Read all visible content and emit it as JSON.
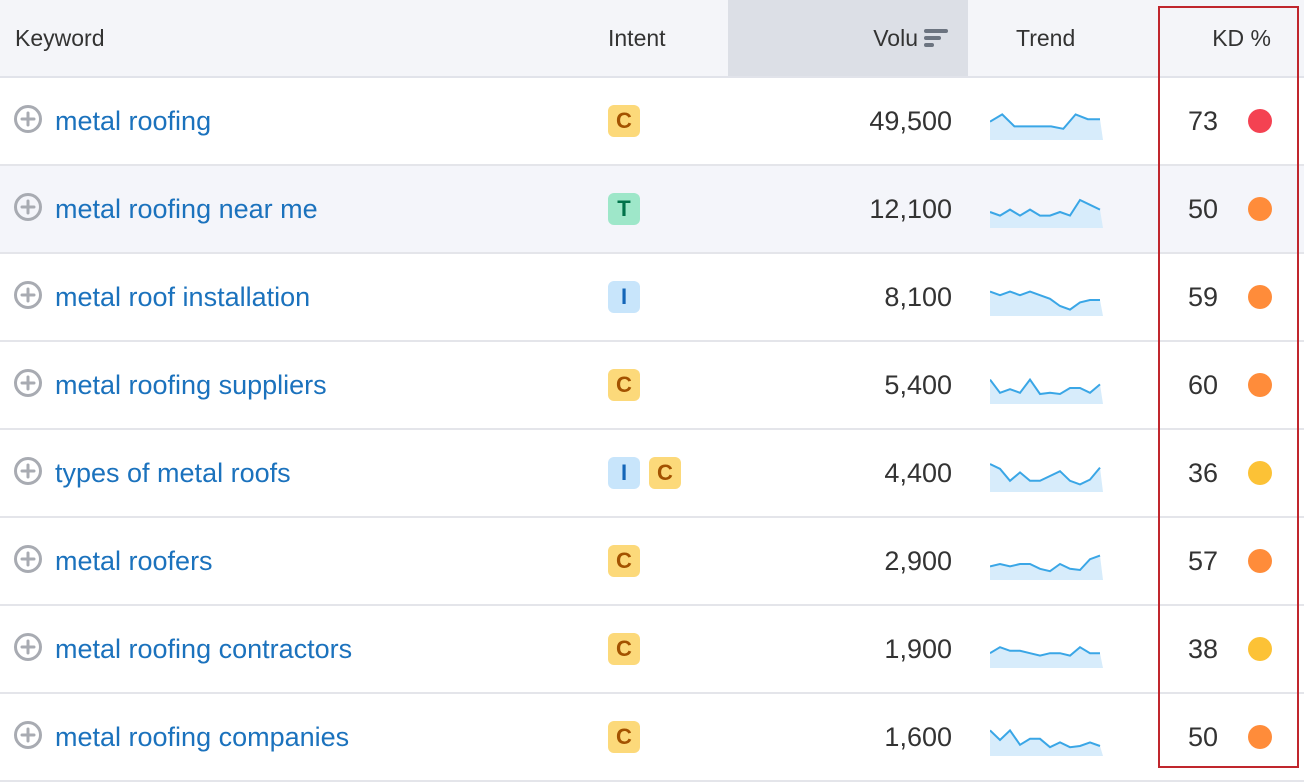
{
  "table": {
    "columns": {
      "keyword": "Keyword",
      "intent": "Intent",
      "volume": "Volu",
      "trend": "Trend",
      "kd": "KD %"
    },
    "sort_icon": "sort-descending-icon",
    "rows": [
      {
        "keyword": "metal roofing",
        "intents": [
          "C"
        ],
        "volume": "49,500",
        "kd": "73",
        "kd_color": "#f44252",
        "trend": [
          0.6,
          0.9,
          0.4,
          0.4,
          0.4,
          0.4,
          0.3,
          0.9,
          0.7,
          0.7
        ]
      },
      {
        "keyword": "metal roofing near me",
        "intents": [
          "T"
        ],
        "volume": "12,100",
        "kd": "50",
        "kd_color": "#ff8c3a",
        "trend": [
          0.5,
          0.35,
          0.6,
          0.35,
          0.6,
          0.35,
          0.35,
          0.5,
          0.35,
          1.0,
          0.8,
          0.6
        ]
      },
      {
        "keyword": "metal roof installation",
        "intents": [
          "I"
        ],
        "volume": "8,100",
        "kd": "59",
        "kd_color": "#ff8c3a",
        "trend": [
          0.85,
          0.7,
          0.85,
          0.7,
          0.85,
          0.7,
          0.55,
          0.25,
          0.1,
          0.4,
          0.5,
          0.5
        ]
      },
      {
        "keyword": "metal roofing suppliers",
        "intents": [
          "C"
        ],
        "volume": "5,400",
        "kd": "60",
        "kd_color": "#ff8c3a",
        "trend": [
          0.85,
          0.3,
          0.45,
          0.3,
          0.85,
          0.25,
          0.3,
          0.25,
          0.5,
          0.5,
          0.3,
          0.65
        ]
      },
      {
        "keyword": "types of metal roofs",
        "intents": [
          "I",
          "C"
        ],
        "volume": "4,400",
        "kd": "36",
        "kd_color": "#fcc236",
        "trend": [
          1.0,
          0.8,
          0.3,
          0.65,
          0.3,
          0.3,
          0.5,
          0.7,
          0.3,
          0.15,
          0.35,
          0.85
        ]
      },
      {
        "keyword": "metal roofers",
        "intents": [
          "C"
        ],
        "volume": "2,900",
        "kd": "57",
        "kd_color": "#ff8c3a",
        "trend": [
          0.4,
          0.5,
          0.4,
          0.5,
          0.5,
          0.3,
          0.2,
          0.5,
          0.3,
          0.25,
          0.7,
          0.85
        ]
      },
      {
        "keyword": "metal roofing contractors",
        "intents": [
          "C"
        ],
        "volume": "1,900",
        "kd": "38",
        "kd_color": "#fcc236",
        "trend": [
          0.45,
          0.7,
          0.55,
          0.55,
          0.45,
          0.35,
          0.45,
          0.45,
          0.35,
          0.7,
          0.45,
          0.45
        ]
      },
      {
        "keyword": "metal roofing companies",
        "intents": [
          "C"
        ],
        "volume": "1,600",
        "kd": "50",
        "kd_color": "#ff8c3a",
        "trend": [
          0.9,
          0.5,
          0.9,
          0.3,
          0.55,
          0.55,
          0.2,
          0.4,
          0.2,
          0.25,
          0.4,
          0.25
        ]
      }
    ]
  },
  "colors": {
    "link": "#1b72bd",
    "trend_line": "#3aa6e6",
    "trend_fill": "#d7ecfb",
    "highlight_box": "#c0262d"
  }
}
